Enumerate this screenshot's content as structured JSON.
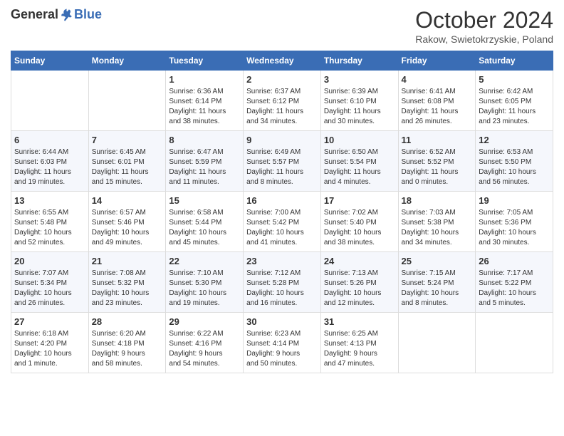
{
  "header": {
    "logo_general": "General",
    "logo_blue": "Blue",
    "title": "October 2024",
    "subtitle": "Rakow, Swietokrzyskie, Poland"
  },
  "weekdays": [
    "Sunday",
    "Monday",
    "Tuesday",
    "Wednesday",
    "Thursday",
    "Friday",
    "Saturday"
  ],
  "weeks": [
    [
      {
        "day": "",
        "detail": ""
      },
      {
        "day": "",
        "detail": ""
      },
      {
        "day": "1",
        "detail": "Sunrise: 6:36 AM\nSunset: 6:14 PM\nDaylight: 11 hours\nand 38 minutes."
      },
      {
        "day": "2",
        "detail": "Sunrise: 6:37 AM\nSunset: 6:12 PM\nDaylight: 11 hours\nand 34 minutes."
      },
      {
        "day": "3",
        "detail": "Sunrise: 6:39 AM\nSunset: 6:10 PM\nDaylight: 11 hours\nand 30 minutes."
      },
      {
        "day": "4",
        "detail": "Sunrise: 6:41 AM\nSunset: 6:08 PM\nDaylight: 11 hours\nand 26 minutes."
      },
      {
        "day": "5",
        "detail": "Sunrise: 6:42 AM\nSunset: 6:05 PM\nDaylight: 11 hours\nand 23 minutes."
      }
    ],
    [
      {
        "day": "6",
        "detail": "Sunrise: 6:44 AM\nSunset: 6:03 PM\nDaylight: 11 hours\nand 19 minutes."
      },
      {
        "day": "7",
        "detail": "Sunrise: 6:45 AM\nSunset: 6:01 PM\nDaylight: 11 hours\nand 15 minutes."
      },
      {
        "day": "8",
        "detail": "Sunrise: 6:47 AM\nSunset: 5:59 PM\nDaylight: 11 hours\nand 11 minutes."
      },
      {
        "day": "9",
        "detail": "Sunrise: 6:49 AM\nSunset: 5:57 PM\nDaylight: 11 hours\nand 8 minutes."
      },
      {
        "day": "10",
        "detail": "Sunrise: 6:50 AM\nSunset: 5:54 PM\nDaylight: 11 hours\nand 4 minutes."
      },
      {
        "day": "11",
        "detail": "Sunrise: 6:52 AM\nSunset: 5:52 PM\nDaylight: 11 hours\nand 0 minutes."
      },
      {
        "day": "12",
        "detail": "Sunrise: 6:53 AM\nSunset: 5:50 PM\nDaylight: 10 hours\nand 56 minutes."
      }
    ],
    [
      {
        "day": "13",
        "detail": "Sunrise: 6:55 AM\nSunset: 5:48 PM\nDaylight: 10 hours\nand 52 minutes."
      },
      {
        "day": "14",
        "detail": "Sunrise: 6:57 AM\nSunset: 5:46 PM\nDaylight: 10 hours\nand 49 minutes."
      },
      {
        "day": "15",
        "detail": "Sunrise: 6:58 AM\nSunset: 5:44 PM\nDaylight: 10 hours\nand 45 minutes."
      },
      {
        "day": "16",
        "detail": "Sunrise: 7:00 AM\nSunset: 5:42 PM\nDaylight: 10 hours\nand 41 minutes."
      },
      {
        "day": "17",
        "detail": "Sunrise: 7:02 AM\nSunset: 5:40 PM\nDaylight: 10 hours\nand 38 minutes."
      },
      {
        "day": "18",
        "detail": "Sunrise: 7:03 AM\nSunset: 5:38 PM\nDaylight: 10 hours\nand 34 minutes."
      },
      {
        "day": "19",
        "detail": "Sunrise: 7:05 AM\nSunset: 5:36 PM\nDaylight: 10 hours\nand 30 minutes."
      }
    ],
    [
      {
        "day": "20",
        "detail": "Sunrise: 7:07 AM\nSunset: 5:34 PM\nDaylight: 10 hours\nand 26 minutes."
      },
      {
        "day": "21",
        "detail": "Sunrise: 7:08 AM\nSunset: 5:32 PM\nDaylight: 10 hours\nand 23 minutes."
      },
      {
        "day": "22",
        "detail": "Sunrise: 7:10 AM\nSunset: 5:30 PM\nDaylight: 10 hours\nand 19 minutes."
      },
      {
        "day": "23",
        "detail": "Sunrise: 7:12 AM\nSunset: 5:28 PM\nDaylight: 10 hours\nand 16 minutes."
      },
      {
        "day": "24",
        "detail": "Sunrise: 7:13 AM\nSunset: 5:26 PM\nDaylight: 10 hours\nand 12 minutes."
      },
      {
        "day": "25",
        "detail": "Sunrise: 7:15 AM\nSunset: 5:24 PM\nDaylight: 10 hours\nand 8 minutes."
      },
      {
        "day": "26",
        "detail": "Sunrise: 7:17 AM\nSunset: 5:22 PM\nDaylight: 10 hours\nand 5 minutes."
      }
    ],
    [
      {
        "day": "27",
        "detail": "Sunrise: 6:18 AM\nSunset: 4:20 PM\nDaylight: 10 hours\nand 1 minute."
      },
      {
        "day": "28",
        "detail": "Sunrise: 6:20 AM\nSunset: 4:18 PM\nDaylight: 9 hours\nand 58 minutes."
      },
      {
        "day": "29",
        "detail": "Sunrise: 6:22 AM\nSunset: 4:16 PM\nDaylight: 9 hours\nand 54 minutes."
      },
      {
        "day": "30",
        "detail": "Sunrise: 6:23 AM\nSunset: 4:14 PM\nDaylight: 9 hours\nand 50 minutes."
      },
      {
        "day": "31",
        "detail": "Sunrise: 6:25 AM\nSunset: 4:13 PM\nDaylight: 9 hours\nand 47 minutes."
      },
      {
        "day": "",
        "detail": ""
      },
      {
        "day": "",
        "detail": ""
      }
    ]
  ]
}
